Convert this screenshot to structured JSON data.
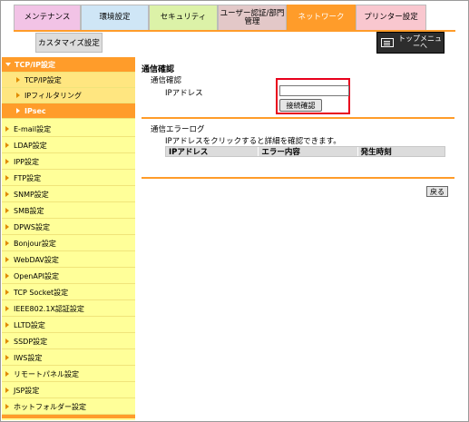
{
  "tabs": [
    "メンテナンス",
    "環境設定",
    "セキュリティ",
    "ユーザー認証/部門管理",
    "ネットワーク",
    "プリンター設定"
  ],
  "subtab": "カスタマイズ設定",
  "topmenu": {
    "label": "トップメニューへ",
    "icon": "list-icon"
  },
  "sidebar": {
    "header": "TCP/IP設定",
    "sub_items": [
      "TCP/IP設定",
      "IPフィルタリング",
      "IPsec"
    ],
    "items": [
      "E-mail設定",
      "LDAP設定",
      "IPP設定",
      "FTP設定",
      "SNMP設定",
      "SMB設定",
      "DPWS設定",
      "Bonjour設定",
      "WebDAV設定",
      "OpenAPI設定",
      "TCP Socket設定",
      "IEEE802.1X認証設定",
      "LLTD設定",
      "SSDP設定",
      "IWS設定",
      "リモートパネル設定",
      "JSP設定",
      "ホットフォルダー設定"
    ]
  },
  "content": {
    "title": "通信確認",
    "section1": "通信確認",
    "ip_label": "IPアドレス",
    "ip_value": "",
    "connect_button": "接続確認",
    "section2": "通信エラーログ",
    "description": "IPアドレスをクリックすると詳細を確認できます。",
    "table_headers": [
      "IPアドレス",
      "エラー内容",
      "発生時刻"
    ],
    "back_button": "戻る"
  },
  "colors": {
    "accent": "#ff9c2a",
    "sidebar_bg": "#ffff99",
    "highlight": "#e8001c"
  }
}
